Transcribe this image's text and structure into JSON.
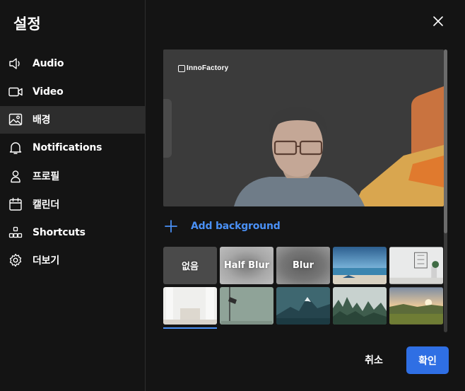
{
  "dialog": {
    "title": "설정"
  },
  "sidebar": {
    "items": [
      {
        "label": "Audio",
        "icon": "speaker-icon",
        "active": false
      },
      {
        "label": "Video",
        "icon": "video-camera-icon",
        "active": false
      },
      {
        "label": "배경",
        "icon": "image-icon",
        "active": true
      },
      {
        "label": "Notifications",
        "icon": "bell-icon",
        "active": false
      },
      {
        "label": "프로필",
        "icon": "person-icon",
        "active": false
      },
      {
        "label": "캘린더",
        "icon": "calendar-icon",
        "active": false
      },
      {
        "label": "Shortcuts",
        "icon": "shortcuts-icon",
        "active": false
      },
      {
        "label": "더보기",
        "icon": "gear-icon",
        "active": false
      }
    ]
  },
  "preview": {
    "logo_text": "InnoFactory"
  },
  "add_background": {
    "label": "Add background",
    "icon": "plus-icon"
  },
  "backgrounds": {
    "options": [
      {
        "label": "없음"
      },
      {
        "label": "Half Blur"
      },
      {
        "label": "Blur"
      },
      {
        "label": ""
      },
      {
        "label": ""
      },
      {
        "label": ""
      },
      {
        "label": ""
      },
      {
        "label": ""
      },
      {
        "label": ""
      },
      {
        "label": ""
      }
    ],
    "selected_index": 5
  },
  "footer": {
    "cancel_label": "취소",
    "confirm_label": "확인"
  },
  "colors": {
    "accent": "#2f6fe4",
    "link": "#4a90f5",
    "active_item": "#2d2d2d",
    "background": "#141414"
  }
}
